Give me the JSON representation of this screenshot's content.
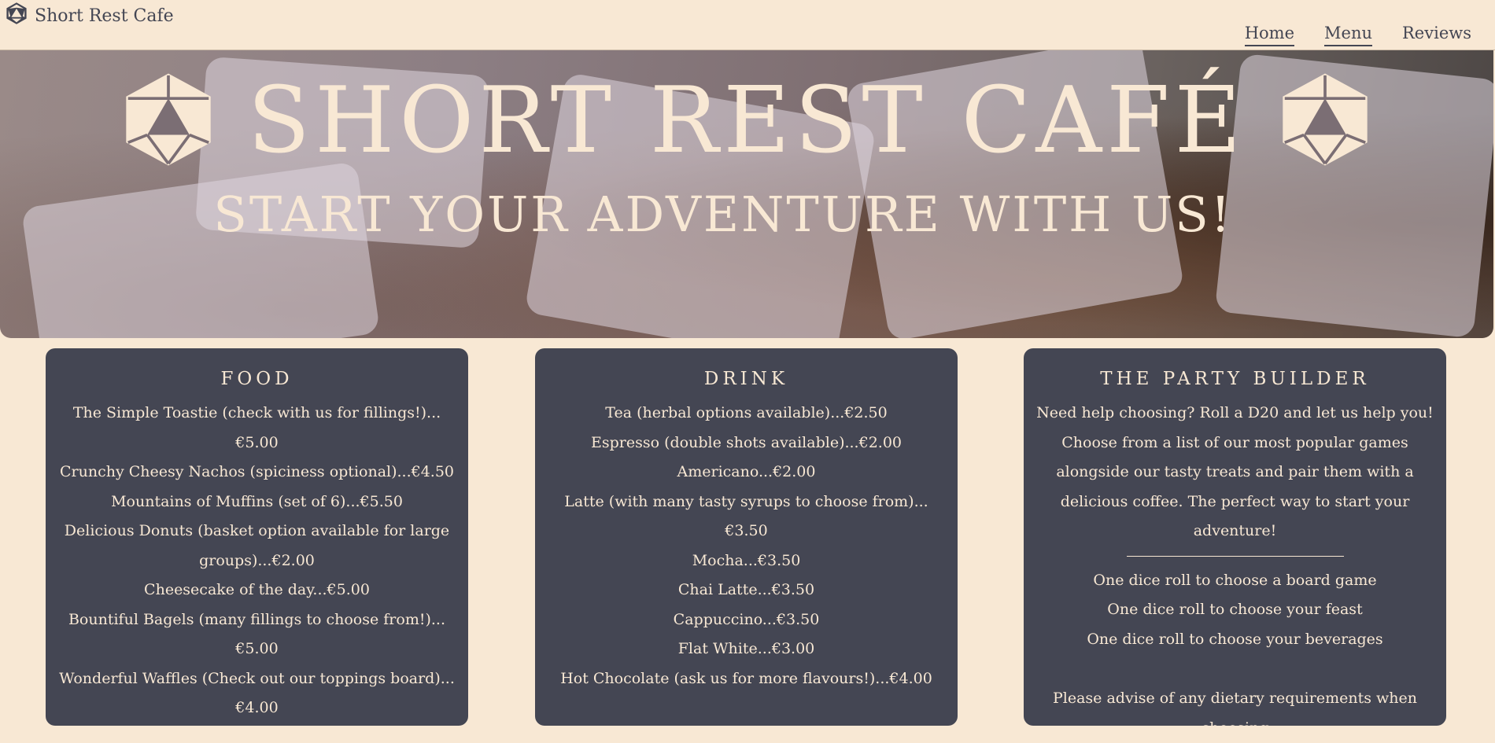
{
  "brand": {
    "name": "Short Rest Cafe",
    "icon": "d20-icon"
  },
  "nav": {
    "items": [
      "Home",
      "Menu",
      "Reviews"
    ]
  },
  "hero": {
    "title": "SHORT REST CAFÉ",
    "subtitle": "START YOUR ADVENTURE WITH US!"
  },
  "food": {
    "heading": "FOOD",
    "items": [
      "The Simple Toastie (check with us for fillings!)...€5.00",
      "Crunchy Cheesy Nachos (spiciness optional)...€4.50",
      "Mountains of Muffins (set of 6)...€5.50",
      "Delicious Donuts (basket option available for large groups)...€2.00",
      "Cheesecake of the day...€5.00",
      "Bountiful Bagels (many fillings to choose from!)...€5.00",
      "Wonderful Waffles (Check out our toppings board)...€4.00"
    ]
  },
  "drink": {
    "heading": "DRINK",
    "items": [
      "Tea (herbal options available)...€2.50",
      "Espresso (double shots available)...€2.00",
      "Americano...€2.00",
      "Latte (with many tasty syrups to choose from)...€3.50",
      "Mocha...€3.50",
      "Chai Latte...€3.50",
      "Cappuccino...€3.50",
      "Flat White...€3.00",
      "Hot Chocolate (ask us for more flavours!)...€4.00"
    ]
  },
  "party": {
    "heading": "THE PARTY BUILDER",
    "intro": "Need help choosing? Roll a D20 and let us help you! Choose from a list of our most popular games alongside our tasty treats and pair them with a delicious coffee. The perfect way to start your adventure!",
    "rolls": [
      "One dice roll to choose a board game",
      "One dice roll to choose your feast",
      "One dice roll to choose your beverages"
    ],
    "note": "Please advise of any dietary requirements when choosing"
  },
  "colors": {
    "background": "#f8e8d4",
    "card": "#444653",
    "text_light": "#f8e8d4",
    "nav_text": "#444653"
  }
}
